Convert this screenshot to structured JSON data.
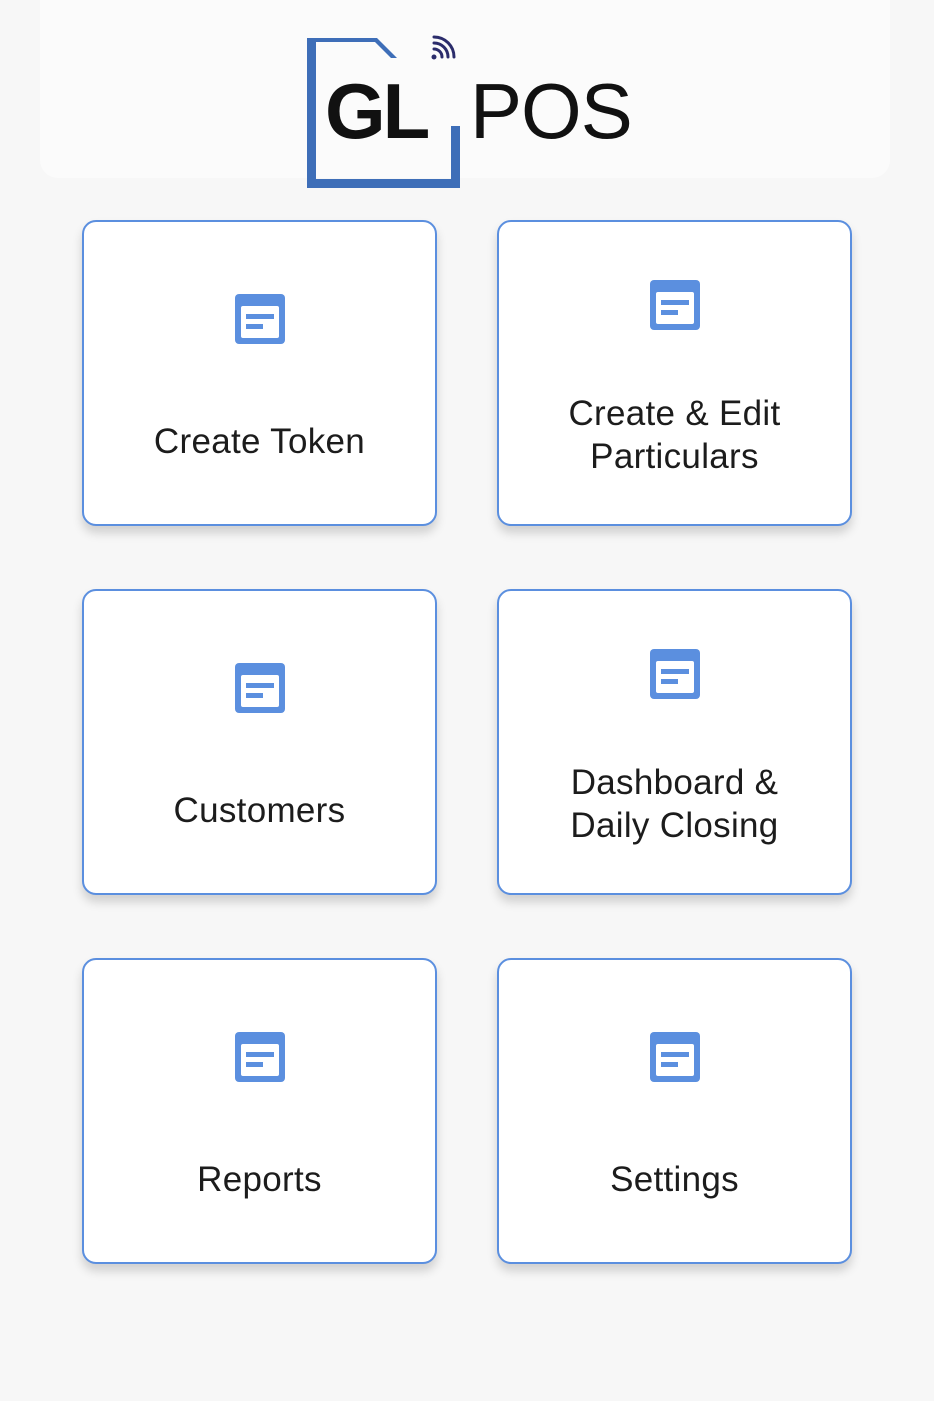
{
  "brand": {
    "logo_text_left": "GL",
    "logo_text_right": "POS",
    "frame_color": "#3e6eb8",
    "signal_color": "#2b2c6b"
  },
  "colors": {
    "card_border": "#5b8fdf",
    "icon": "#5b8fdf",
    "background": "#f7f7f7"
  },
  "menu": {
    "items": [
      {
        "label": "Create Token",
        "icon": "document-icon"
      },
      {
        "label": "Create & Edit\nParticulars",
        "icon": "document-icon"
      },
      {
        "label": "Customers",
        "icon": "document-icon"
      },
      {
        "label": "Dashboard &\nDaily Closing",
        "icon": "document-icon"
      },
      {
        "label": "Reports",
        "icon": "document-icon"
      },
      {
        "label": "Settings",
        "icon": "document-icon"
      }
    ]
  }
}
